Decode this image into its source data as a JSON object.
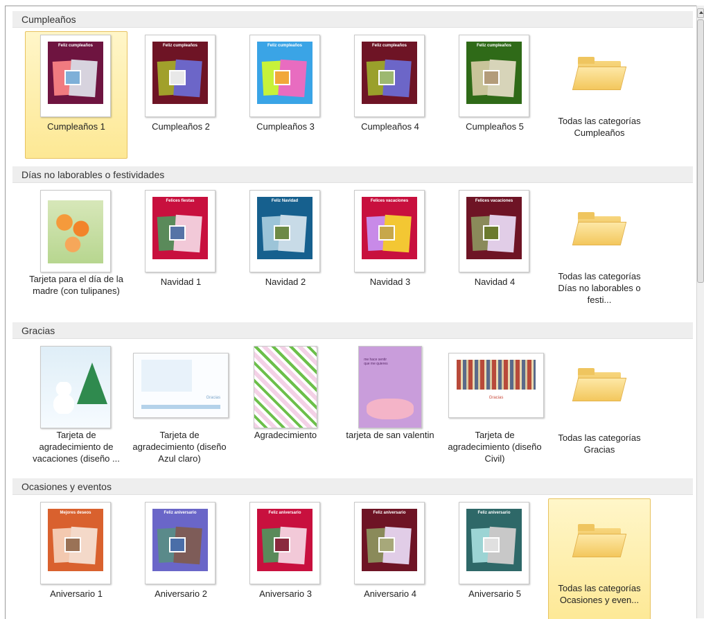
{
  "sections": [
    {
      "title": "Cumpleaños",
      "items": [
        {
          "label": "Cumpleaños  1",
          "head": "Feliz cumpleaños",
          "bg": "#6e1440",
          "p1": "#f07b80",
          "p2": "#d7d3de",
          "photo": "#7eb0d8"
        },
        {
          "label": "Cumpleaños  2",
          "head": "Feliz cumpleaños",
          "bg": "#6e1425",
          "p1": "#a1a02b",
          "p2": "#6c66c8",
          "photo": "#e8e8e8"
        },
        {
          "label": "Cumpleaños  3",
          "head": "Feliz cumpleaños",
          "bg": "#3aa4e6",
          "p1": "#c7f23a",
          "p2": "#e86cc0",
          "photo": "#f1a83a"
        },
        {
          "label": "Cumpleaños  4",
          "head": "Feliz cumpleaños",
          "bg": "#6e1425",
          "p1": "#9aa02b",
          "p2": "#6c66c8",
          "photo": "#9db871"
        },
        {
          "label": "Cumpleaños  5",
          "head": "Feliz cumpleaños",
          "bg": "#2f6a18",
          "p1": "#c9c49a",
          "p2": "#d7d4b9",
          "photo": "#b39c7a"
        }
      ],
      "folder_label": "Todas las categorías Cumpleaños"
    },
    {
      "title": "Días no laborables o festividades",
      "items": [
        {
          "label": "Tarjeta para el día de la madre (con tulipanes)",
          "kind": "flower"
        },
        {
          "label": "Navidad  1",
          "head": "Felices fiestas",
          "bg": "#c8103e",
          "p1": "#5a8a5a",
          "p2": "#f2c9d8",
          "photo": "#5673a6"
        },
        {
          "label": "Navidad  2",
          "head": "Feliz Navidad",
          "bg": "#16608e",
          "p1": "#9cc4d8",
          "p2": "#c8dbe7",
          "photo": "#6e8a46"
        },
        {
          "label": "Navidad  3",
          "head": "Felices vacaciones",
          "bg": "#c8103e",
          "p1": "#c88ae8",
          "p2": "#f3c733",
          "photo": "#c7a74a"
        },
        {
          "label": "Navidad  4",
          "head": "Felices vacaciones",
          "bg": "#6e1425",
          "p1": "#8a8a5a",
          "p2": "#e1cde7",
          "photo": "#6b7a2e"
        }
      ],
      "folder_label": "Todas las categorías Días no laborables o festi..."
    },
    {
      "title": "Gracias",
      "items": [
        {
          "label": "Tarjeta de agradecimiento de vacaciones (diseño ...",
          "kind": "snow"
        },
        {
          "label": "Tarjeta de agradecimiento (diseño Azul claro)",
          "kind": "blue",
          "text": "Gracias"
        },
        {
          "label": "Agradecimiento",
          "kind": "pattern"
        },
        {
          "label": "tarjeta de san valentin",
          "kind": "valentine",
          "text": "me hace sentir que me quieres"
        },
        {
          "label": "Tarjeta de agradecimiento (diseño Civil)",
          "kind": "books",
          "text": "Gracias"
        }
      ],
      "folder_label": "Todas las categorías Gracias"
    },
    {
      "title": "Ocasiones y eventos",
      "items": [
        {
          "label": "Aniversario 1",
          "head": "Mejores deseos",
          "bg": "#d9612e",
          "p1": "#f3c9b0",
          "p2": "#f4d9c9",
          "photo": "#9a7256"
        },
        {
          "label": "Aniversario 2",
          "head": "Feliz aniversario",
          "bg": "#6a66c8",
          "p1": "#5a8a8a",
          "p2": "#7e5c58",
          "photo": "#4a6ea8"
        },
        {
          "label": "Aniversario 3",
          "head": "Feliz aniversario",
          "bg": "#c8103e",
          "p1": "#5a8a5a",
          "p2": "#f2c9d8",
          "photo": "#8a2a3e"
        },
        {
          "label": "Aniversario 4",
          "head": "Feliz aniversario",
          "bg": "#6e1425",
          "p1": "#8a8a5a",
          "p2": "#e1cde7",
          "photo": "#a7a87a"
        },
        {
          "label": "Aniversario 5",
          "head": "Feliz aniversario",
          "bg": "#2e6868",
          "p1": "#9cd4d4",
          "p2": "#c8c8c8",
          "photo": "#e0e0e0"
        }
      ],
      "folder_label": "Todas las categorías Ocasiones y even..."
    }
  ]
}
